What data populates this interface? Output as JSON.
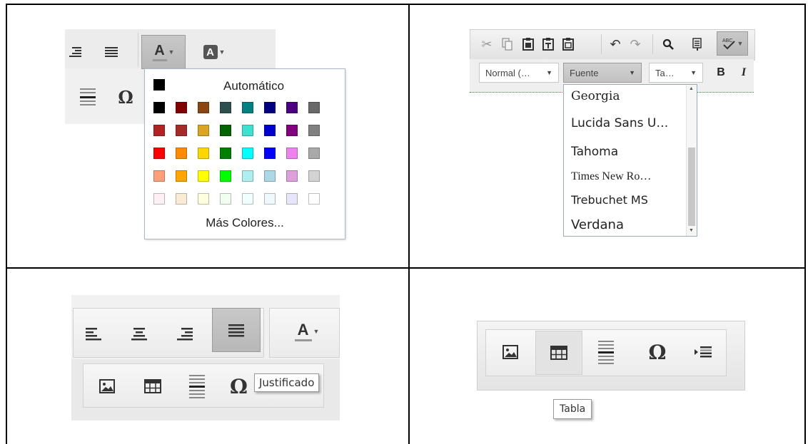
{
  "panel_tl": {
    "text_color_button": {
      "letter": "A",
      "icon": "text-color-icon"
    },
    "bg_color_button": {
      "letter": "A",
      "icon": "background-color-icon"
    },
    "color_popup": {
      "automatic_label": "Automático",
      "more_colors_label": "Más Colores...",
      "automatic_color": "#000000",
      "colors": [
        [
          "#000000",
          "#800000",
          "#8B4513",
          "#2F4F4F",
          "#008080",
          "#000080",
          "#4B0082",
          "#696969"
        ],
        [
          "#B22222",
          "#A52A2A",
          "#DAA520",
          "#006400",
          "#40E0D0",
          "#0000CD",
          "#800080",
          "#808080"
        ],
        [
          "#FF0000",
          "#FF8C00",
          "#FFD700",
          "#008000",
          "#00FFFF",
          "#0000FF",
          "#EE82EE",
          "#A9A9A9"
        ],
        [
          "#FFA07A",
          "#FFA500",
          "#FFFF00",
          "#00FF00",
          "#AFEEEE",
          "#ADD8E6",
          "#DDA0DD",
          "#D3D3D3"
        ],
        [
          "#FFF0F5",
          "#FAEBD7",
          "#FFFFE0",
          "#F0FFF0",
          "#F0FFFF",
          "#F0F8FF",
          "#E6E6FA",
          "#FFFFFF"
        ]
      ]
    },
    "omega_symbol": "Ω"
  },
  "panel_tr": {
    "style_combo": {
      "value": "Normal (…"
    },
    "font_combo": {
      "value": "Fuente"
    },
    "size_combo": {
      "value": "Ta…"
    },
    "bold_label": "B",
    "italic_label": "I",
    "font_options": [
      "Georgia",
      "Lucida Sans U…",
      "Tahoma",
      "Times New Ro…",
      "Trebuchet MS",
      "Verdana"
    ]
  },
  "panel_bl": {
    "text_color_letter": "A",
    "tooltip": "Justificado",
    "omega_symbol": "Ω"
  },
  "panel_br": {
    "omega_symbol": "Ω",
    "tooltip": "Tabla"
  }
}
